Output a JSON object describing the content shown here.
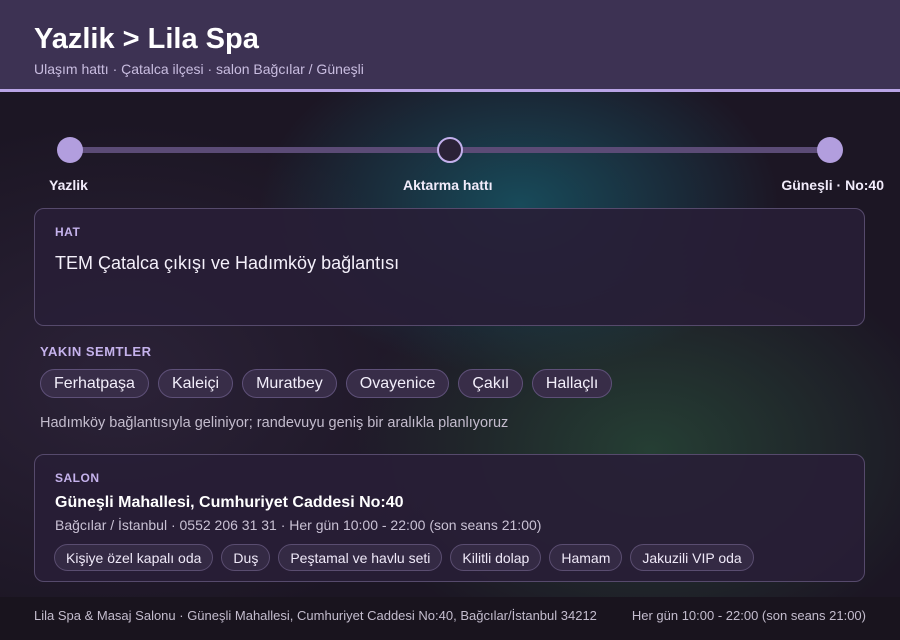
{
  "header": {
    "title": "Yazlik > Lila Spa",
    "subtitle": "Ulaşım hattı · Çatalca ilçesi · salon Bağcılar / Güneşli"
  },
  "route": {
    "stops": [
      {
        "label": "Yazlik"
      },
      {
        "label": "Aktarma hattı"
      },
      {
        "label": "Güneşli · No:40"
      }
    ]
  },
  "line_card": {
    "label": "HAT",
    "text": "TEM Çatalca çıkışı ve Hadımköy bağlantısı"
  },
  "nearby": {
    "title": "YAKIN SEMTLER",
    "items": [
      "Ferhatpaşa",
      "Kaleiçi",
      "Muratbey",
      "Ovayenice",
      "Çakıl",
      "Hallaçlı"
    ],
    "note": "Hadımköy bağlantısıyla geliniyor; randevuyu geniş bir aralıkla planlıyoruz"
  },
  "salon": {
    "label": "SALON",
    "address": "Güneşli Mahallesi, Cumhuriyet Caddesi No:40",
    "details": "Bağcılar / İstanbul · 0552 206 31 31 · Her gün 10:00 - 22:00 (son seans 21:00)",
    "amenities": [
      "Kişiye özel kapalı oda",
      "Duş",
      "Peştamal ve havlu seti",
      "Kilitli dolap",
      "Hamam",
      "Jakuzili VIP oda"
    ]
  },
  "footer": {
    "left": "Lila Spa & Masaj Salonu · Güneşli Mahallesi, Cumhuriyet Caddesi No:40, Bağcılar/İstanbul 34212",
    "right": "Her gün 10:00 - 22:00 (son seans 21:00)"
  },
  "colors": {
    "accent": "#b9a4e6",
    "header_bg": "#3d3253",
    "page_bg": "#1c1624"
  }
}
